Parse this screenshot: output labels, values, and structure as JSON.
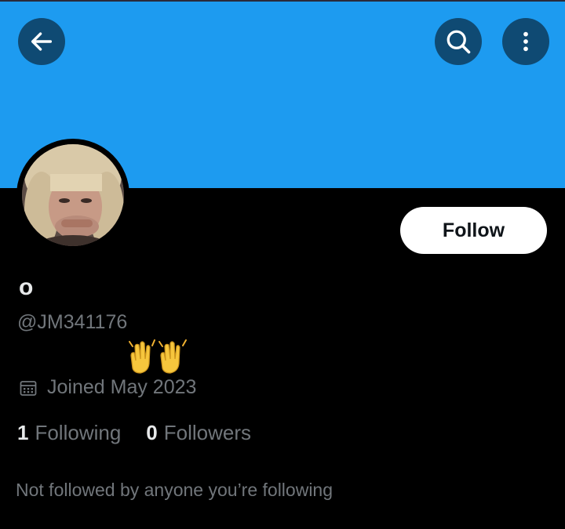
{
  "header": {
    "back_icon": "arrow-left-icon",
    "search_icon": "search-icon",
    "more_icon": "more-vertical-icon",
    "banner_color": "#1d9bf0",
    "button_color": "#0f4a73"
  },
  "profile": {
    "display_name": "o",
    "handle": "@JM341176",
    "bio_emoji": "🙌",
    "joined": "Joined May 2023",
    "follow_button": "Follow",
    "following_count": "1",
    "following_label": "Following",
    "followers_count": "0",
    "followers_label": "Followers",
    "not_followed_text": "Not followed by anyone you’re following"
  },
  "colors": {
    "background": "#000000",
    "primary_text": "#e7e9ea",
    "secondary_text": "#71767b"
  }
}
